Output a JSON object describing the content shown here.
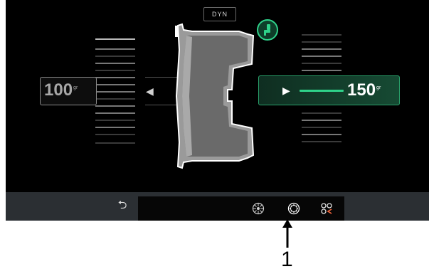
{
  "header": {
    "mode_label": "DYN"
  },
  "left_plane": {
    "value": "100",
    "unit": "gr"
  },
  "right_plane": {
    "value": "150",
    "unit": "gr"
  },
  "scales": {
    "left": {
      "highlighted_tick": "top"
    },
    "right": {
      "highlighted_tick": "none"
    }
  },
  "status": {
    "icon": "operator-seated-icon",
    "color": "#2fd28a"
  },
  "toolbar": {
    "back_icon": "back-arrow-icon",
    "tabs": [
      {
        "icon": "wheel-settings-icon",
        "selected": false
      },
      {
        "icon": "wheel-balance-icon",
        "selected": true
      },
      {
        "icon": "menu-grid-icon",
        "selected": false
      }
    ]
  },
  "callout": {
    "label": "1"
  },
  "colors": {
    "accent": "#2fd28a",
    "panel": "#164a33",
    "toolbar": "#2b2f33"
  }
}
